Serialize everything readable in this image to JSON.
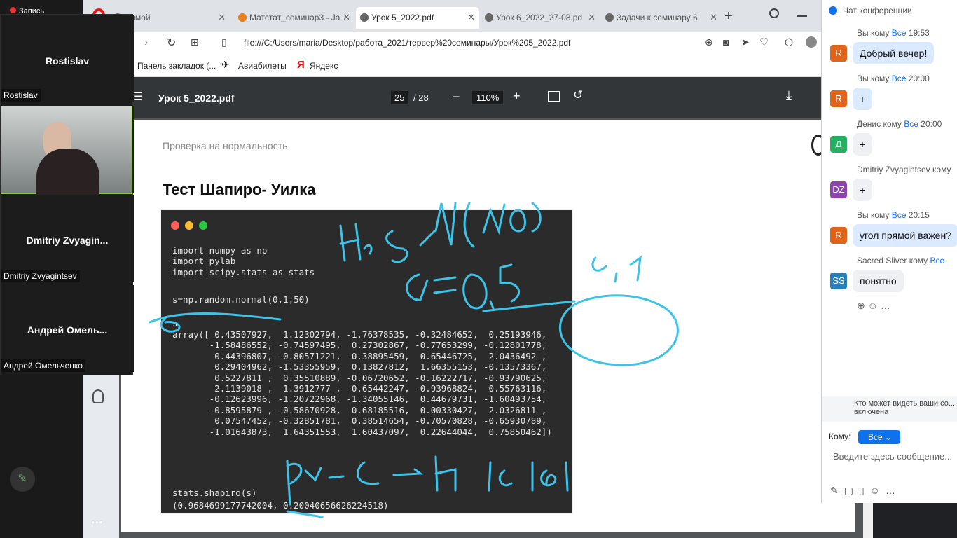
{
  "recording": "Запись",
  "participants": [
    {
      "name": "Rostislav",
      "label": "Rostislav"
    },
    {
      "name": "",
      "label": ""
    },
    {
      "name": "Dmitriy  Zvyagin...",
      "label": "Dmitriy Zvyagintsev"
    },
    {
      "name": "Андрей  Омель...",
      "label": "Андрей Омельченко"
    }
  ],
  "tabs": [
    "Домой",
    "Матстат_семинар3 - Ja",
    "Урок 5_2022.pdf",
    "Урок 6_2022_27-08.pd",
    "Задачи к семинару 6"
  ],
  "address": "file:///C:/Users/maria/Desktop/работа_2021/тервер%20семинары/Урок%205_2022.pdf",
  "bookmarks": [
    "Панель закладок (...",
    "Авиабилеты",
    "Яндекс"
  ],
  "pdf": {
    "title": "Урок 5_2022.pdf",
    "page": "25",
    "total": "/ 28",
    "zoom": "110%"
  },
  "slide": {
    "subtitle": "Проверка на нормальность",
    "title": "Тест Шапиро- Уилка"
  },
  "code": {
    "imports": [
      "import numpy as np",
      "import pylab",
      "import scipy.stats as stats"
    ],
    "assign": "s=np.random.normal(0,1,50)",
    "echo": "s",
    "array": [
      "array([ 0.43507927,  1.12302794, -1.76378535, -0.32484652,  0.25193946,",
      "       -1.58486552, -0.74597495,  0.27302867, -0.77653299, -0.12801778,",
      "        0.44396807, -0.80571221, -0.38895459,  0.65446725,  2.0436492 ,",
      "        0.29404962, -1.53355959,  0.13827812,  1.66355153, -0.13573367,",
      "        0.5227811 ,  0.35510889, -0.06720652, -0.16222717, -0.93790625,",
      "        2.1139018 ,  1.3912777 , -0.65442247, -0.93968824,  0.55763116,",
      "       -0.12623996, -1.20722968, -1.34055146,  0.44679731, -1.60493754,",
      "       -0.8595879 , -0.58670928,  0.68185516,  0.00330427,  2.0326811 ,",
      "        0.07547452, -0.32851781,  0.38514654, -0.70570828, -0.65930789,",
      "       -1.01643873,  1.64351553,  1.60437097,  0.22644044,  0.75850462])"
    ],
    "call": "stats.shapiro(s)",
    "result": "(0.9684699177742004, 0.20040656626224518)"
  },
  "chat": {
    "header": "Чат конференции",
    "to_all": "Все",
    "messages": [
      {
        "from": "Вы кому",
        "to": "Все",
        "time": "19:53",
        "avatar": "R",
        "color": "#e0641a",
        "text": "Добрый вечер!",
        "mine": true
      },
      {
        "from": "Вы кому",
        "to": "Все",
        "time": "20:00",
        "avatar": "R",
        "color": "#e0641a",
        "text": "+",
        "mine": true
      },
      {
        "from": "Денис кому",
        "to": "Все",
        "time": "20:00",
        "avatar": "Д",
        "color": "#27ae60",
        "text": "+",
        "mine": false
      },
      {
        "from": "Dmitriy Zvyagintsev кому",
        "to": "",
        "time": "",
        "avatar": "DZ",
        "color": "#8e44ad",
        "text": "+",
        "mine": false
      },
      {
        "from": "Вы кому",
        "to": "Все",
        "time": "20:15",
        "avatar": "R",
        "color": "#e0641a",
        "text": "угол прямой важен?",
        "mine": true
      },
      {
        "from": "Sacred Sliver кому",
        "to": "Все",
        "time": "",
        "avatar": "SS",
        "color": "#2980b9",
        "text": "понятно",
        "mine": false
      }
    ],
    "notice": "Кто может видеть ваши со... включена",
    "recipient_label": "Кому:",
    "recipient": "Все",
    "placeholder": "Введите здесь сообщение..."
  }
}
